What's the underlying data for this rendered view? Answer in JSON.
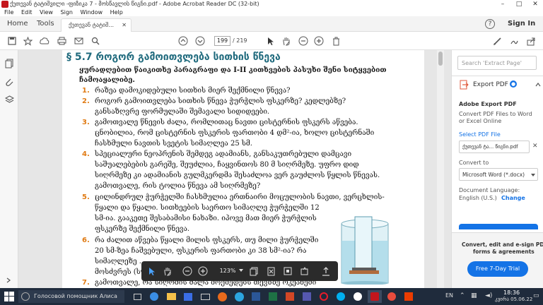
{
  "window": {
    "title": "ქუთევან ტატიშვილი -ფიზიკა 7 - მოსწავლის წიგნი.pdf - Adobe Acrobat Reader DC (32-bit)",
    "minimize": "–",
    "maximize": "□",
    "close": "✕"
  },
  "menu": [
    "File",
    "Edit",
    "View",
    "Sign",
    "Window",
    "Help"
  ],
  "tabs": {
    "home": "Home",
    "tools": "Tools",
    "doc": "ქუთევან ტატიშ...",
    "doc_close": "✕"
  },
  "header": {
    "signin": "Sign In",
    "help": "?"
  },
  "toolbar": {
    "page_current": "199",
    "page_total": "/ 219"
  },
  "document": {
    "heading": "§ 5.7  როგორ გამოითვლება სითხის წნევა",
    "intro_lines": [
      "ყურადღებით წაიკითხე პარაგრაფი და I-II კითხვების პასუხი შენი სიტყვებით",
      "ჩამოაყალიბე."
    ],
    "questions": [
      {
        "num": "1.",
        "lines": [
          "რაზეა დამოკიდებული სითხის მიერ შექმნილი წნევა?"
        ]
      },
      {
        "num": "2.",
        "lines": [
          "როგორ  გამოითვლება  სითხის  წნევა  ჭურჭლის  ფსკერზე?  კედლებზე?",
          "განსაზღვრე ფორმულაში შემავალი სიდიდეები."
        ]
      },
      {
        "num": "3.",
        "lines": [
          "გამოთვალე წნევის ძალა, რომლითაც ნავთი ცისტერნის ფსკერს აწვება.",
          "ცნობილია, რომ ცისტერნის ფსკერის ფართობი 4 დმ²-ია, ხოლო ცისტერნაში",
          "ჩასხმული ნავთის სვეტის სიმაღლეა 25 სმ."
        ]
      },
      {
        "num": "4.",
        "lines": [
          "სპეციალური  ნეოპრენის  შემდეგ  ადამიანს,  განსაკუთრებული  დამცავი",
          "საშუალებების გარეშე, შეუძლია, ჩაყვინთოს 80 მ სიღრმეზე. უფრო დიდ",
          "სიღრმეზე კი ადამიანის გულმკერდმა შესაძლოა ვერ გაუძლოს წყლის წნევას.",
          "გამოთვალე, რის ტოლია წნევა ამ სიღრმეზე?"
        ]
      },
      {
        "num": "5.",
        "lines": [
          "ცილინდრულ ჭურჭელში ჩასხმულია ერთნაირი მოცულობის ნავთი, ვერცხლის-",
          "წყალი და წყალი. სითხეების საერთო სიმაღლე ჭურჭელში 12",
          "სმ-ია. გააკეთე შესაბამისი ნახაზი. იპოვე მათ მიერ ჭურჭლის",
          "ფსკერზე შექმნილი წნევა."
        ]
      },
      {
        "num": "6.",
        "lines": [
          "რა ძალით აწვება წყალი მილის ფსკერს, თუ მილი ჭურჭელში",
          "20 სმ-ზეა ჩაშვებული, ფსკერის ფართობი კი 38 სმ²-ია? რა",
          "სიმაღლეზე ...",
          "მოსძვრეს (სურ...)"
        ]
      },
      {
        "num": "7.",
        "lines": [
          "გამოთვალე, რა სიღრმის ძალა მოქმედებს თევზზე ოკეანეში"
        ]
      }
    ]
  },
  "floatbar": {
    "zoom": "123%"
  },
  "right_panel": {
    "search_placeholder": "Search 'Extract Page'",
    "export_title": "Export PDF",
    "adobe_export": "Adobe Export PDF",
    "convert_desc_lines": [
      "Convert PDF Files to Word",
      "or Excel Online"
    ],
    "select_file_label": "Select PDF File",
    "file_name": "ქუთევან ტა... წიგნი.pdf",
    "convert_to_label": "Convert to",
    "convert_to_value": "Microsoft Word (*.docx)",
    "doc_lang_label": "Document Language:",
    "doc_lang_value": "English (U.S.)",
    "change_link": "Change",
    "promo_lines": [
      "Convert, edit and e-sign PDF",
      "forms & agreements"
    ],
    "trial_button": "Free 7-Day Trial"
  },
  "taskbar": {
    "search_text": "Голосовой помощник Алиса",
    "lang": "EN",
    "time": "18:36",
    "date": "კვირა 05.06.22"
  },
  "colors": {
    "accent": "#1473e6",
    "heading": "#1f6a7d",
    "number": "#e07b14",
    "taskbar": "#1f2b3c"
  }
}
